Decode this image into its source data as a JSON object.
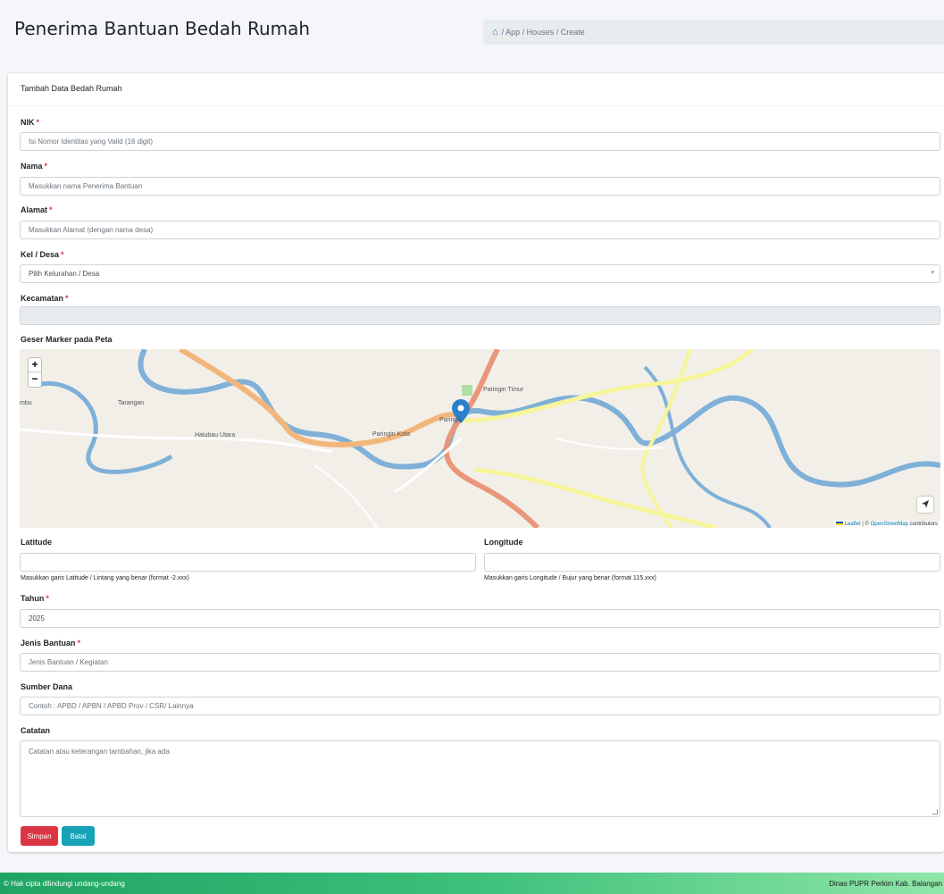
{
  "header": {
    "title": "Penerima Bantuan Bedah Rumah",
    "breadcrumb": "/ App / Houses / Create"
  },
  "card": {
    "title": "Tambah Data Bedah Rumah"
  },
  "form": {
    "nik": {
      "label": "NIK",
      "placeholder": "Isi Nomor Identitas yang Valid (16 digit)"
    },
    "nama": {
      "label": "Nama",
      "placeholder": "Masukkan nama Penerima Bantuan"
    },
    "alamat": {
      "label": "Alamat",
      "placeholder": "Masukkan Alamat (dengan nama desa)"
    },
    "desa": {
      "label": "Kel / Desa",
      "selected": "Pilih Kelurahan / Desa"
    },
    "kecamatan": {
      "label": "Kecamatan",
      "value": ""
    },
    "map_label": "Geser Marker pada Peta",
    "latitude": {
      "label": "Latitude",
      "value": "",
      "hint": "Masukkan garis Latitude / Lintang yang benar (format -2.xxx)"
    },
    "longitude": {
      "label": "Longitude",
      "value": "",
      "hint": "Masukkan garis Longitude / Bujur yang benar (format 115.xxx)"
    },
    "tahun": {
      "label": "Tahun",
      "value": "2025"
    },
    "jenis": {
      "label": "Jenis Bantuan",
      "placeholder": "Jenis Bantuan / Kegiatan"
    },
    "sumber": {
      "label": "Sumber Dana",
      "placeholder": "Contoh : APBD / APBN / APBD Prov / CSR/ Lainnya"
    },
    "catatan": {
      "label": "Catatan",
      "placeholder": "Catatan atau keterangan tambahan, jika ada"
    },
    "required_mark": "*"
  },
  "buttons": {
    "save": "Simpan",
    "cancel": "Batal"
  },
  "map": {
    "zoom_in": "+",
    "zoom_out": "−",
    "attribution_leaflet": "Leaflet",
    "attribution_sep": " | © ",
    "attribution_osm": "OpenStreetMap",
    "attribution_contrib": " contributors",
    "places": {
      "paringin": "Paringin",
      "paringin_kota": "Paringin Kota",
      "paringin_timur": "Paringin Timur",
      "tarangan": "Tarangan",
      "halubau": "Halubau Utara",
      "mbu": "mbu"
    }
  },
  "footer": {
    "copyright": "© Hak cipta dilindungi undang-undang",
    "org": "Dinas PUPR Perkim Kab. Balangan"
  },
  "colors": {
    "primary": "#007bff",
    "danger": "#dc3545",
    "info": "#17a2b8",
    "footer": "#1fa463"
  }
}
